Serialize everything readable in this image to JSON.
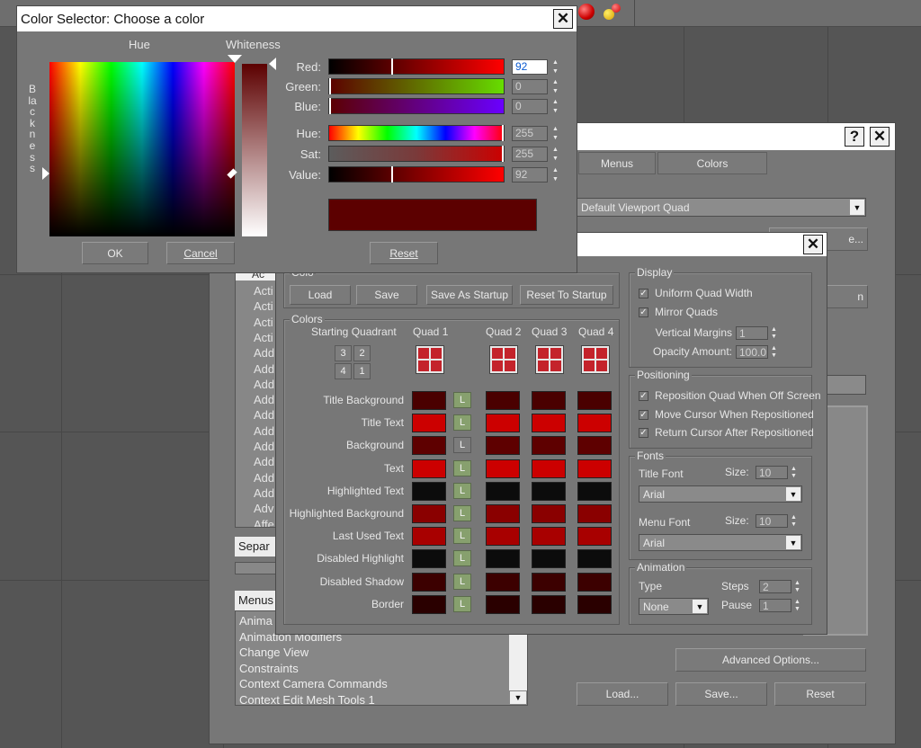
{
  "colors": {
    "swatch_dark": "#4a0000",
    "swatch_mid": "#5e0000",
    "swatch_bright": "#cc0000",
    "swatch_black": "#0c0c0c",
    "quad_fill": "#c4232b"
  },
  "taskbar": {
    "icons": [
      "red-ball-icon",
      "juggle-icon"
    ]
  },
  "color_selector": {
    "title": "Color Selector: Choose a color",
    "hue_label": "Hue",
    "whiteness_label": "Whiteness",
    "blackness_label": "Blackness",
    "close_glyph": "✕",
    "sliders": [
      {
        "label": "Red:",
        "value": "92",
        "pos": 0.36
      },
      {
        "label": "Green:",
        "value": "0",
        "pos": 0.0
      },
      {
        "label": "Blue:",
        "value": "0",
        "pos": 0.0
      },
      {
        "label": "Hue:",
        "value": "255",
        "pos": 1.0
      },
      {
        "label": "Sat:",
        "value": "255",
        "pos": 1.0
      },
      {
        "label": "Value:",
        "value": "92",
        "pos": 0.36
      }
    ],
    "preview_color": "#5c0000",
    "ok": "OK",
    "cancel": "Cancel",
    "reset": "Reset"
  },
  "customize": {
    "help_glyph": "?",
    "close_glyph": "✕",
    "tabs": [
      "Menus",
      "Colors"
    ],
    "scheme": "Default Viewport Quad",
    "actions_list": [
      "Acti",
      "Acti",
      "Acti",
      "Acti",
      "Add",
      "Add",
      "Add",
      "Add",
      "Add",
      "Add",
      "Add",
      "Add",
      "Add",
      "Add",
      "Adv",
      "Affe"
    ],
    "header_partial": "Ac",
    "separator_label": "Separ",
    "menus_label": "Menus",
    "menus_list": [
      "Anima",
      "Animation Modifiers",
      "Change View",
      "Constraints",
      "Context Camera Commands",
      "Context Edit Mesh Tools 1"
    ],
    "advanced": "Advanced Options...",
    "load": "Load...",
    "save": "Save...",
    "reset": "Reset"
  },
  "quad_dialog": {
    "close_glyph": "✕",
    "file_group": "Colo",
    "load": "Load",
    "save": "Save",
    "save_startup": "Save As Startup",
    "reset_startup": "Reset To Startup",
    "colors_group": "Colors",
    "starting_quadrant": "Starting Quadrant",
    "quadrant_cells": [
      "3",
      "2",
      "4",
      "1"
    ],
    "quad_headers": [
      "Quad 1",
      "Quad 2",
      "Quad 3",
      "Quad 4"
    ],
    "rows": [
      {
        "label": "Title Background",
        "c": [
          "#4a0000",
          "#4a0000",
          "#4a0000",
          "#4a0000"
        ],
        "lock": true
      },
      {
        "label": "Title Text",
        "c": [
          "#cc0000",
          "#cc0000",
          "#cc0000",
          "#cc0000"
        ],
        "lock": true
      },
      {
        "label": "Background",
        "c": [
          "#5e0000",
          "#5e0000",
          "#5e0000",
          "#5e0000"
        ],
        "lock": false
      },
      {
        "label": "Text",
        "c": [
          "#cc0000",
          "#cc0000",
          "#cc0000",
          "#cc0000"
        ],
        "lock": true
      },
      {
        "label": "Highlighted Text",
        "c": [
          "#0c0c0c",
          "#0c0c0c",
          "#0c0c0c",
          "#0c0c0c"
        ],
        "lock": true
      },
      {
        "label": "Highlighted Background",
        "c": [
          "#8a0000",
          "#8a0000",
          "#8a0000",
          "#8a0000"
        ],
        "lock": true
      },
      {
        "label": "Last Used Text",
        "c": [
          "#a80000",
          "#a80000",
          "#a80000",
          "#a80000"
        ],
        "lock": true
      },
      {
        "label": "Disabled Highlight",
        "c": [
          "#0c0c0c",
          "#0c0c0c",
          "#0c0c0c",
          "#0c0c0c"
        ],
        "lock": true
      },
      {
        "label": "Disabled Shadow",
        "c": [
          "#3c0000",
          "#3c0000",
          "#3c0000",
          "#3c0000"
        ],
        "lock": true
      },
      {
        "label": "Border",
        "c": [
          "#2a0000",
          "#2a0000",
          "#2a0000",
          "#2a0000"
        ],
        "lock": true
      }
    ],
    "lock_letter": "L",
    "display_group": "Display",
    "uniform_quad_width": "Uniform Quad Width",
    "mirror_quads": "Mirror Quads",
    "vertical_margins_label": "Vertical Margins",
    "vertical_margins": "1",
    "opacity_label": "Opacity Amount:",
    "opacity": "100.0",
    "positioning_group": "Positioning",
    "reposition": "Reposition Quad When Off Screen",
    "move_cursor": "Move Cursor When Repositioned",
    "return_cursor": "Return Cursor After Repositioned",
    "fonts_group": "Fonts",
    "title_font_label": "Title Font",
    "size_label": "Size:",
    "title_font_size": "10",
    "title_font": "Arial",
    "menu_font_label": "Menu Font",
    "menu_font_size": "10",
    "menu_font": "Arial",
    "animation_group": "Animation",
    "type_label": "Type",
    "type_value": "None",
    "steps_label": "Steps",
    "steps": "2",
    "pause_label": "Pause",
    "pause": "1"
  }
}
